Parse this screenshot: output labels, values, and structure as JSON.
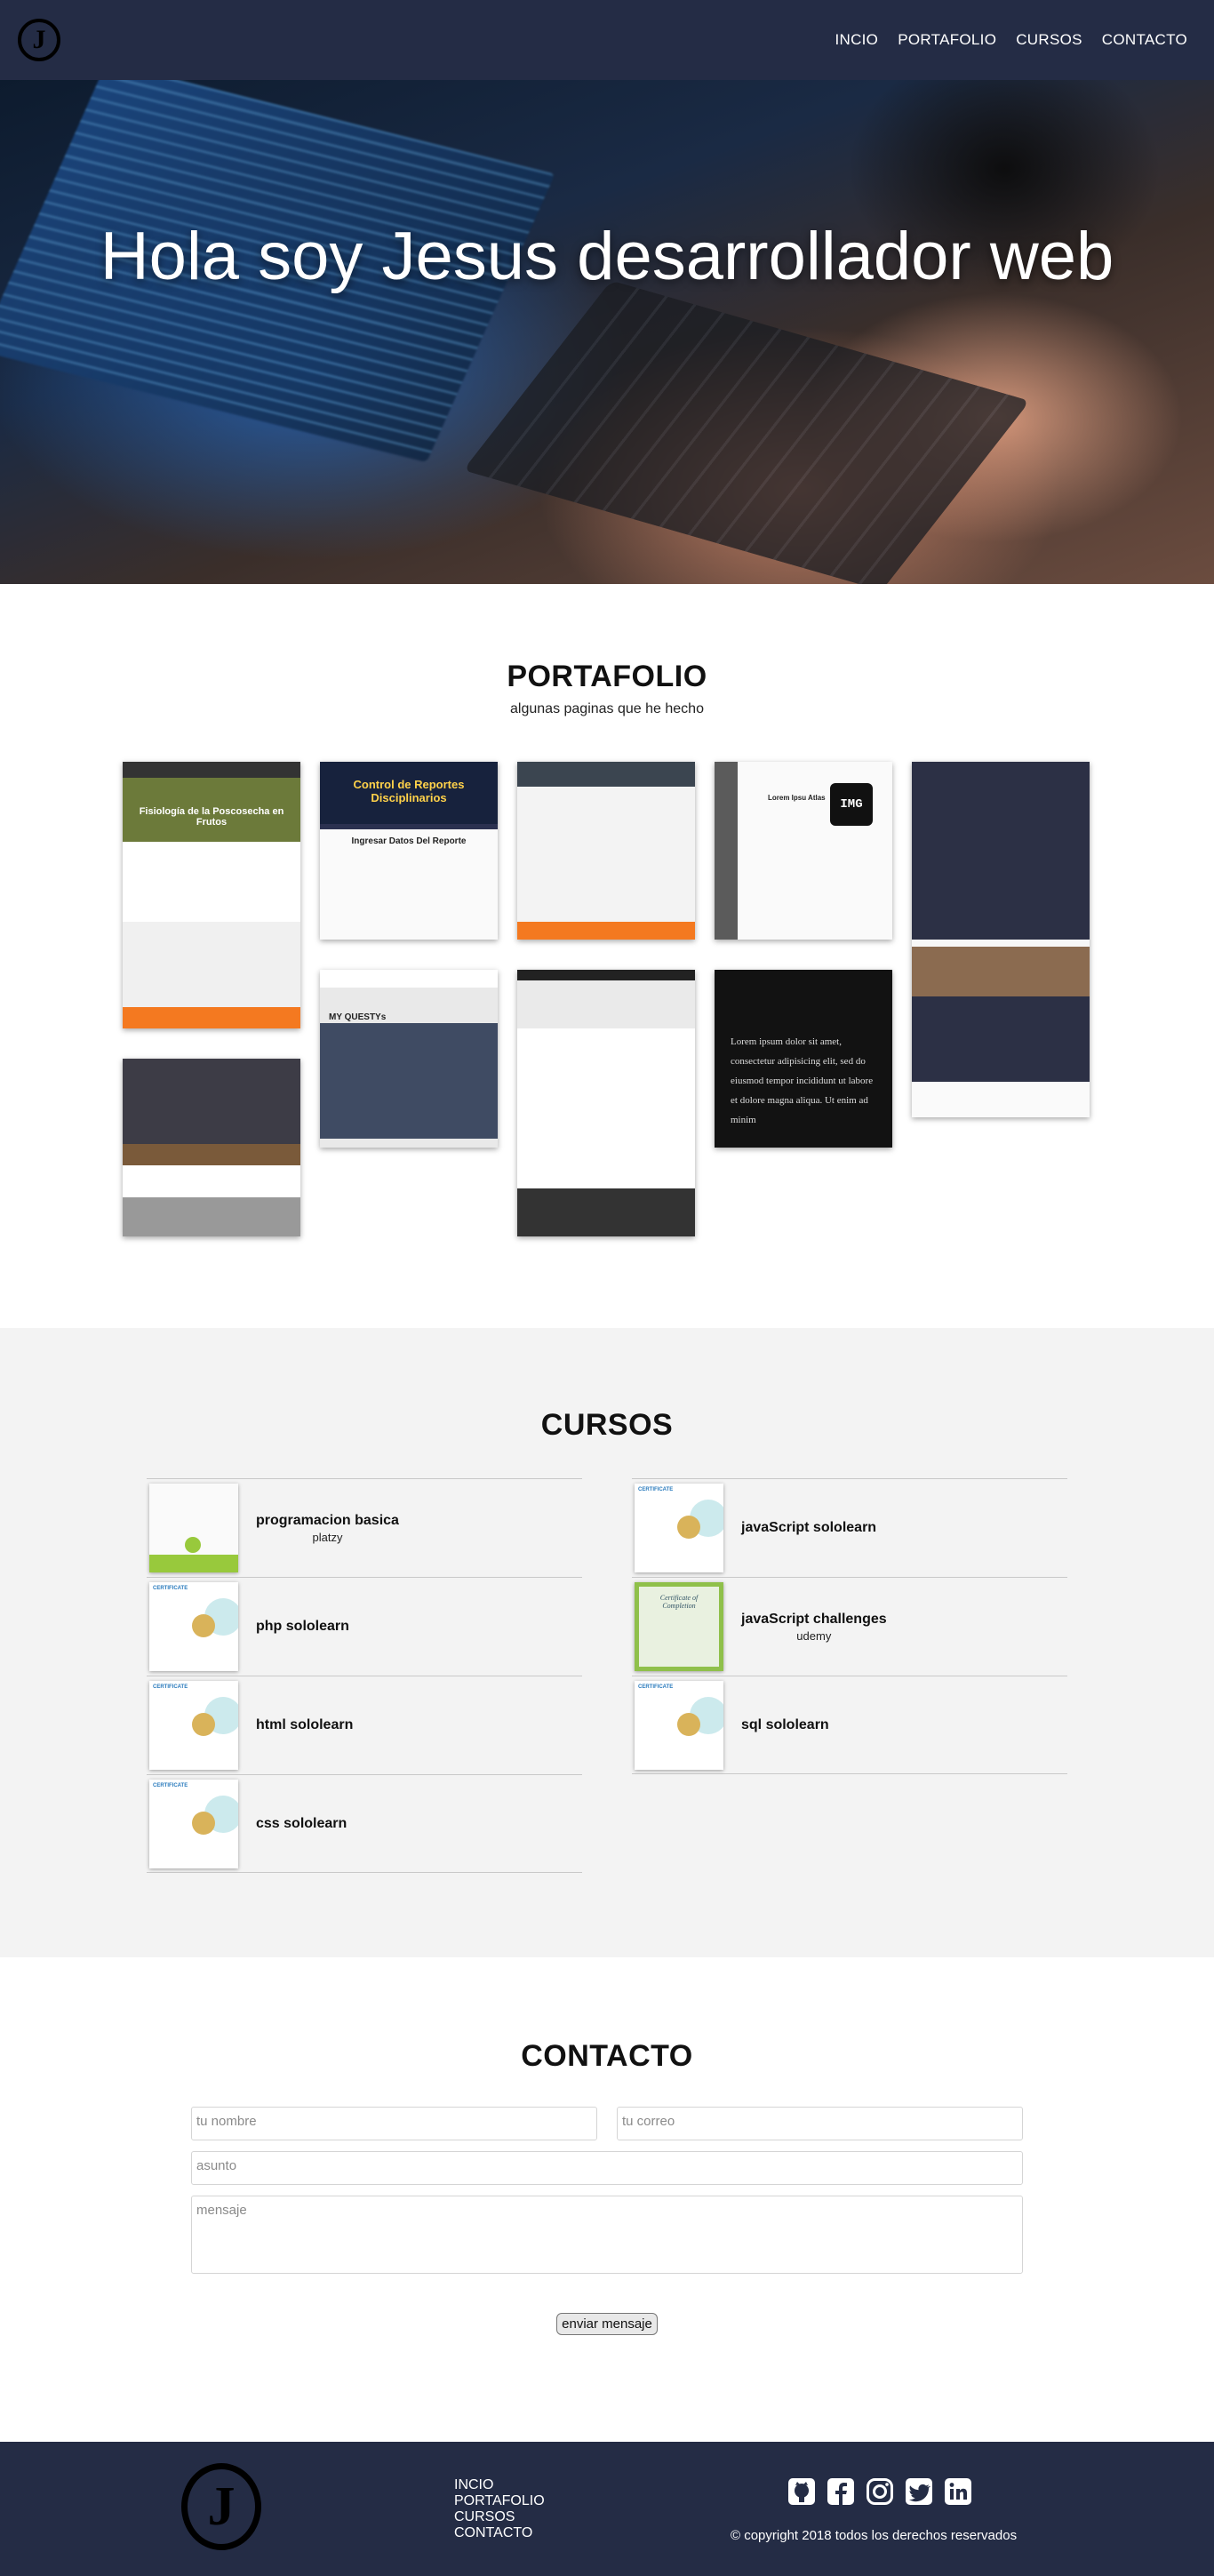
{
  "nav": {
    "logo_letter": "J",
    "links": [
      "INCIO",
      "PORTAFOLIO",
      "CURSOS",
      "CONTACTO"
    ]
  },
  "hero": {
    "title": "Hola soy Jesus desarrollador web"
  },
  "portfolio": {
    "title": "PORTAFOLIO",
    "subtitle": "algunas paginas que he hecho",
    "items": [
      {
        "caption": "Fisiología de la Poscosecha en Frutos"
      },
      {
        "caption": "Control de Reportes Disciplinarios",
        "sub": "Ingresar Datos Del Reporte"
      },
      {
        "caption": ""
      },
      {
        "caption": "Lorem Ipsu Atlas",
        "badge": "IMG"
      },
      {
        "caption": ""
      },
      {
        "caption": "MY QUESTYs"
      },
      {
        "caption": ""
      },
      {
        "caption": "Lorem ipsum dolor sit amet, consectetur adipisicing elit, sed do eiusmod tempor incididunt ut labore et dolore magna aliqua. Ut enim ad minim"
      },
      {
        "caption": ""
      }
    ]
  },
  "cursos": {
    "title": "CURSOS",
    "courses": [
      {
        "name": "programacion basica",
        "issuer": "platzy",
        "cert": "platzi"
      },
      {
        "name": "javaScript sololearn",
        "issuer": "",
        "cert": "sololearn"
      },
      {
        "name": "php sololearn",
        "issuer": "",
        "cert": "sololearn"
      },
      {
        "name": "javaScript challenges",
        "issuer": "udemy",
        "cert": "udemy"
      },
      {
        "name": "html sololearn",
        "issuer": "",
        "cert": "sololearn"
      },
      {
        "name": "sql sololearn",
        "issuer": "",
        "cert": "sololearn"
      },
      {
        "name": "css sololearn",
        "issuer": "",
        "cert": "sololearn"
      }
    ]
  },
  "contacto": {
    "title": "CONTACTO",
    "name_placeholder": "tu nombre",
    "email_placeholder": "tu correo",
    "subject_placeholder": "asunto",
    "message_placeholder": "mensaje",
    "send_label": "enviar mensaje"
  },
  "footer": {
    "logo_letter": "J",
    "links": [
      "INCIO",
      "PORTAFOLIO",
      "CURSOS",
      "CONTACTO"
    ],
    "socials": [
      "github-icon",
      "facebook-icon",
      "instagram-icon",
      "twitter-icon",
      "linkedin-icon"
    ],
    "copyright": "© copyright 2018 todos los derechos reservados"
  },
  "colors": {
    "nav_bg": "#242c45",
    "section_alt_bg": "#f3f3f3"
  }
}
